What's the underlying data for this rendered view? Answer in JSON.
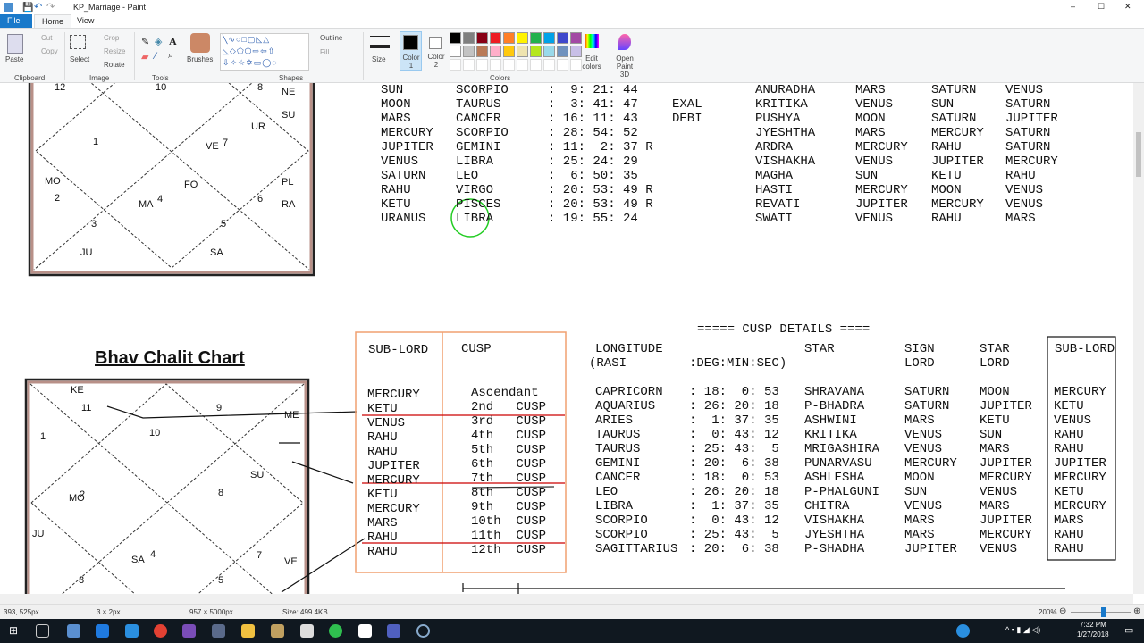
{
  "window": {
    "title": "KP_Marriage - Paint",
    "minimize": "–",
    "maximize": "☐",
    "close": "✕"
  },
  "tabs": [
    {
      "label": "File"
    },
    {
      "label": "Home"
    },
    {
      "label": "View"
    }
  ],
  "ribbon": {
    "clipboard": {
      "paste": "Paste",
      "cut": "Cut",
      "copy": "Copy",
      "group": "Clipboard"
    },
    "image": {
      "select": "Select",
      "crop": "Crop",
      "resize": "Resize",
      "rotate": "Rotate",
      "group": "Image"
    },
    "tools": {
      "group": "Tools"
    },
    "brushes": "Brushes",
    "shapes": {
      "outline": "Outline",
      "fill": "Fill",
      "group": "Shapes"
    },
    "size": "Size",
    "color1": "Color 1",
    "color2": "Color 2",
    "colors_group": "Colors",
    "edit_colors": "Edit colors",
    "paint3d": "Open Paint 3D",
    "palette": [
      "#000000",
      "#7f7f7f",
      "#880015",
      "#ed1c24",
      "#ff7f27",
      "#fff200",
      "#22b14c",
      "#00a2e8",
      "#3f48cc",
      "#a349a4",
      "#ffffff",
      "#c3c3c3",
      "#b97a57",
      "#ffaec9",
      "#ffc90e",
      "#efe4b0",
      "#b5e61d",
      "#99d9ea",
      "#7092be",
      "#c8bfe7"
    ]
  },
  "rasi_chart": {
    "labels": [
      "12",
      "10",
      "8",
      "NE",
      "SU",
      "UR",
      "1",
      "VE",
      "7",
      "MO",
      "2",
      "FO",
      "MA",
      "4",
      "PL",
      "6",
      "RA",
      "3",
      "5",
      "JU",
      "SA"
    ]
  },
  "planets": {
    "rows": [
      [
        "SUN",
        "SCORPIO",
        ":  9: 21: 44",
        "",
        "ANURADHA",
        "MARS",
        "SATURN",
        "VENUS"
      ],
      [
        "MOON",
        "TAURUS",
        ":  3: 41: 47",
        "EXAL",
        "KRITIKA",
        "VENUS",
        "SUN",
        "SATURN"
      ],
      [
        "MARS",
        "CANCER",
        ": 16: 11: 43",
        "DEBI",
        "PUSHYA",
        "MOON",
        "SATURN",
        "JUPITER"
      ],
      [
        "MERCURY",
        "SCORPIO",
        ": 28: 54: 52",
        "",
        "JYESHTHA",
        "MARS",
        "MERCURY",
        "SATURN"
      ],
      [
        "JUPITER",
        "GEMINI",
        ": 11:  2: 37 R",
        "",
        "ARDRA",
        "MERCURY",
        "RAHU",
        "SATURN"
      ],
      [
        "VENUS",
        "LIBRA",
        ": 25: 24: 29",
        "",
        "VISHAKHA",
        "VENUS",
        "JUPITER",
        "MERCURY"
      ],
      [
        "SATURN",
        "LEO",
        ":  6: 50: 35",
        "",
        "MAGHA",
        "SUN",
        "KETU",
        "RAHU"
      ],
      [
        "RAHU",
        "VIRGO",
        ": 20: 53: 49 R",
        "",
        "HASTI",
        "MERCURY",
        "MOON",
        "VENUS"
      ],
      [
        "KETU",
        "PISCES",
        ": 20: 53: 49 R",
        "",
        "REVATI",
        "JUPITER",
        "MERCURY",
        "VENUS"
      ],
      [
        "URANUS",
        "LIBRA",
        ": 19: 55: 24",
        "",
        "SWATI",
        "VENUS",
        "RAHU",
        "MARS"
      ]
    ]
  },
  "bhav_chart": {
    "title": "Bhav Chalit Chart",
    "labels": [
      "KE",
      "11",
      "9",
      "ME",
      "1",
      "10",
      "SU",
      "MO",
      "2",
      "8",
      "JU",
      "VE",
      "SA",
      "4",
      "7",
      "3",
      "5"
    ]
  },
  "summary": {
    "sub_lord_header": "SUB-LORD",
    "cusp_header": "CUSP",
    "sub_lords": [
      "MERCURY",
      "KETU",
      "VENUS",
      "RAHU",
      "RAHU",
      "JUPITER",
      "MERCURY",
      "KETU",
      "MERCURY",
      "MARS",
      "RAHU",
      "RAHU"
    ],
    "cusps": [
      "Ascendant",
      "2nd   CUSP",
      "3rd   CUSP",
      "4th   CUSP",
      "5th   CUSP",
      "6th   CUSP",
      "7th   CUSP",
      "8th   CUSP",
      "9th   CUSP",
      "10th  CUSP",
      "11th  CUSP",
      "12th  CUSP"
    ]
  },
  "cusp_details": {
    "title": "===== CUSP DETAILS ====",
    "headers": {
      "longitude": "LONGITUDE",
      "rasi": "(RASI",
      "dms": ":DEG:MIN:SEC)",
      "star": "STAR",
      "sign_lord_1": "SIGN",
      "sign_lord_2": "LORD",
      "star_lord_1": "STAR",
      "star_lord_2": "LORD",
      "sub_lord": "SUB-LORD"
    },
    "rows": [
      [
        "CAPRICORN",
        ": 18:  0: 53",
        "SHRAVANA",
        "SATURN",
        "MOON",
        "MERCURY"
      ],
      [
        "AQUARIUS",
        ": 26: 20: 18",
        "P-BHADRA",
        "SATURN",
        "JUPITER",
        "KETU"
      ],
      [
        "ARIES",
        ":  1: 37: 35",
        "ASHWINI",
        "MARS",
        "KETU",
        "VENUS"
      ],
      [
        "TAURUS",
        ":  0: 43: 12",
        "KRITIKA",
        "VENUS",
        "SUN",
        "RAHU"
      ],
      [
        "TAURUS",
        ": 25: 43:  5",
        "MRIGASHIRA",
        "VENUS",
        "MARS",
        "RAHU"
      ],
      [
        "GEMINI",
        ": 20:  6: 38",
        "PUNARVASU",
        "MERCURY",
        "JUPITER",
        "JUPITER"
      ],
      [
        "CANCER",
        ": 18:  0: 53",
        "ASHLESHA",
        "MOON",
        "MERCURY",
        "MERCURY"
      ],
      [
        "LEO",
        ": 26: 20: 18",
        "P-PHALGUNI",
        "SUN",
        "VENUS",
        "KETU"
      ],
      [
        "LIBRA",
        ":  1: 37: 35",
        "CHITRA",
        "VENUS",
        "MARS",
        "MERCURY"
      ],
      [
        "SCORPIO",
        ":  0: 43: 12",
        "VISHAKHA",
        "MARS",
        "JUPITER",
        "MARS"
      ],
      [
        "SCORPIO",
        ": 25: 43:  5",
        "JYESHTHA",
        "MARS",
        "MERCURY",
        "RAHU"
      ],
      [
        "SAGITTARIUS",
        ": 20:  6: 38",
        "P-SHADHA",
        "JUPITER",
        "VENUS",
        "RAHU"
      ]
    ]
  },
  "status": {
    "cursor": "393, 525px",
    "selection": "3 × 2px",
    "canvas_size": "957 × 5000px",
    "file_size": "Size: 499.4KB",
    "zoom": "200%",
    "zoom_value": 200
  },
  "taskbar": {
    "time": "7:32 PM",
    "date": "1/27/2018"
  },
  "colors": {
    "file_tab": "#1979ca",
    "orange_box": "#f0a070",
    "red_line": "#cc0000",
    "cursor_circle": "#22cc22"
  }
}
